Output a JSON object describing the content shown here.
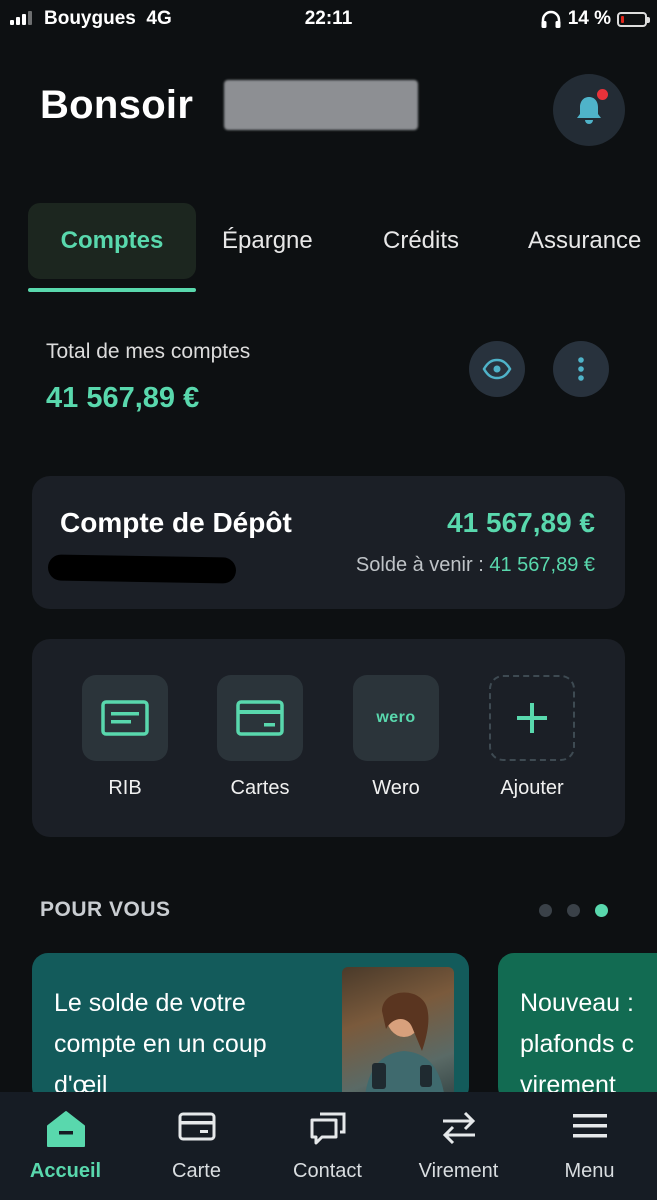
{
  "status_bar": {
    "carrier": "Bouygues",
    "network": "4G",
    "time": "22:11",
    "battery": "14 %"
  },
  "greeting": {
    "text": "Bonsoir"
  },
  "tabs": [
    {
      "label": "Comptes",
      "active": true
    },
    {
      "label": "Épargne"
    },
    {
      "label": "Crédits"
    },
    {
      "label": "Assurance"
    }
  ],
  "total": {
    "label": "Total de mes comptes",
    "amount": "41 567,89 €"
  },
  "account": {
    "name": "Compte de Dépôt",
    "balance": "41 567,89 €",
    "upcoming_label": "Solde à venir :",
    "upcoming_amount": "41 567,89 €"
  },
  "quick_actions": [
    {
      "label": "RIB",
      "icon": "rib-icon"
    },
    {
      "label": "Cartes",
      "icon": "card-icon"
    },
    {
      "label": "Wero",
      "icon": "wero-logo",
      "logo_text": "wero"
    },
    {
      "label": "Ajouter",
      "icon": "plus-icon"
    }
  ],
  "pour_vous": {
    "title": "POUR VOUS",
    "cards": [
      {
        "text_lines": [
          "Le solde de votre",
          "compte en un coup",
          "d'œil"
        ]
      },
      {
        "text_lines": [
          "Nouveau :",
          "plafonds c",
          "virement"
        ]
      }
    ],
    "pager_active_index": 2
  },
  "bottom_nav": [
    {
      "label": "Accueil",
      "active": true
    },
    {
      "label": "Carte"
    },
    {
      "label": "Contact"
    },
    {
      "label": "Virement"
    },
    {
      "label": "Menu"
    }
  ],
  "colors": {
    "accent": "#59d8ad",
    "background": "#0d1012",
    "card": "#1b1f26",
    "notification": "#e8323a"
  }
}
